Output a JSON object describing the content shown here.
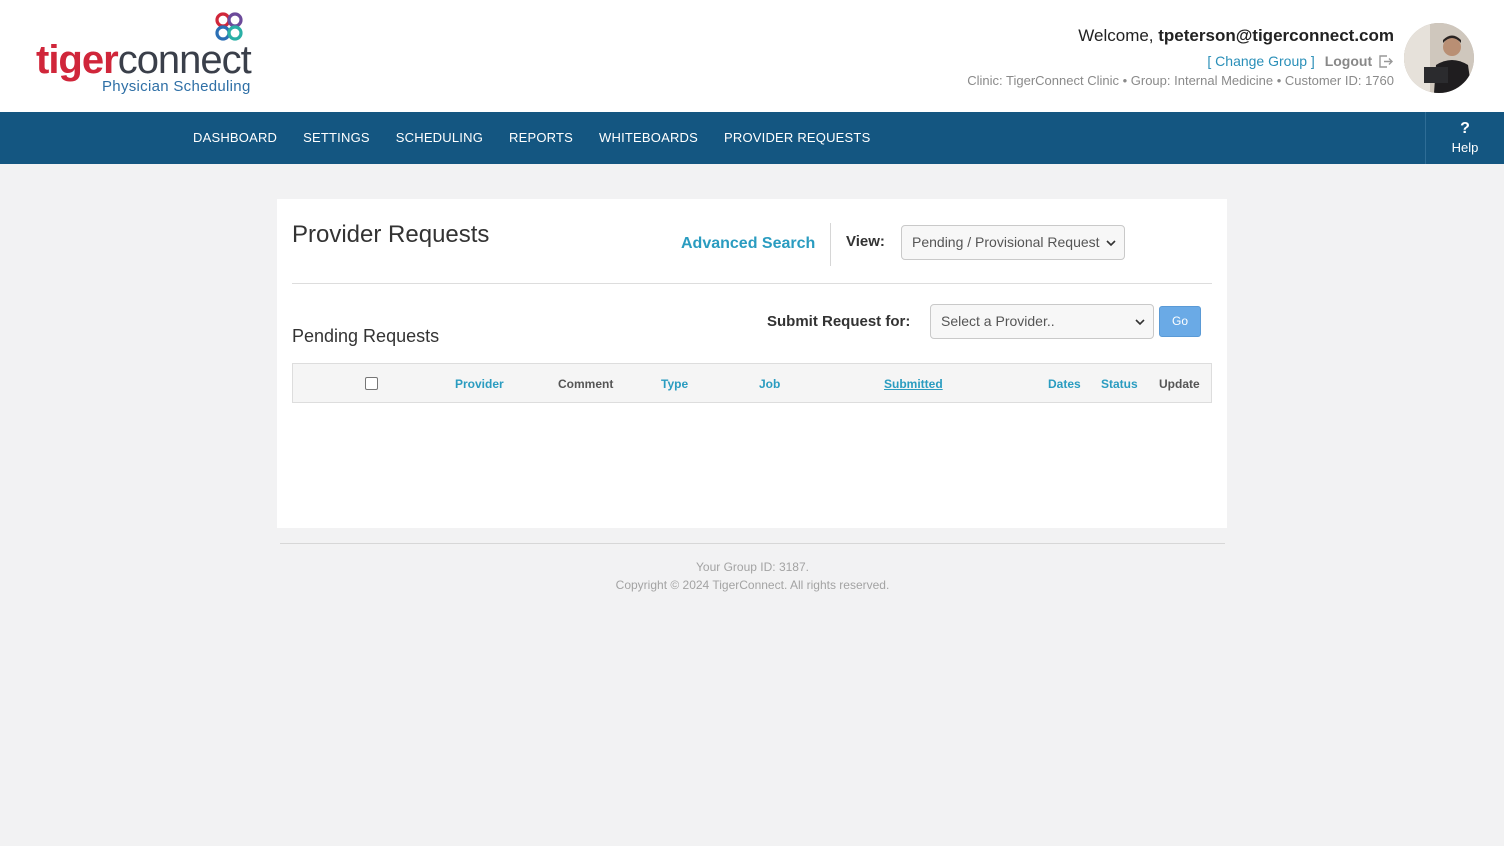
{
  "header": {
    "logo": {
      "word_part1": "tiger",
      "word_part2": "connect",
      "subtitle": "Physician Scheduling"
    },
    "welcome_prefix": "Welcome,",
    "user_email": "tpeterson@tigerconnect.com",
    "change_group_label": "[ Change Group ]",
    "logout_label": "Logout",
    "clinic_info": "Clinic: TigerConnect Clinic • Group: Internal Medicine • Customer ID: 1760"
  },
  "nav": {
    "items": [
      {
        "label": "DASHBOARD"
      },
      {
        "label": "SETTINGS"
      },
      {
        "label": "SCHEDULING"
      },
      {
        "label": "REPORTS"
      },
      {
        "label": "WHITEBOARDS"
      },
      {
        "label": "PROVIDER REQUESTS"
      }
    ],
    "help_symbol": "?",
    "help_label": "Help"
  },
  "main": {
    "title": "Provider Requests",
    "advanced_search_label": "Advanced Search",
    "view_label": "View:",
    "view_selected": "Pending / Provisional Request",
    "section_title": "Pending Requests",
    "submit_label": "Submit Request for:",
    "provider_select_placeholder": "Select a Provider..",
    "go_label": "Go",
    "table_columns": {
      "provider": "Provider",
      "comment": "Comment",
      "type": "Type",
      "job": "Job",
      "submitted": "Submitted",
      "dates": "Dates",
      "status": "Status",
      "update": "Update"
    }
  },
  "footer": {
    "group_id": "Your Group ID: 3187.",
    "copyright": "Copyright © 2024 TigerConnect. All rights reserved."
  },
  "colors": {
    "brand_red": "#d0263a",
    "nav_blue": "#145681",
    "link_teal": "#2a9cc0",
    "go_button": "#6aaae6"
  },
  "icons": [
    "logo-mark-icon",
    "logout-icon",
    "chevron-down-icon",
    "help-icon"
  ]
}
